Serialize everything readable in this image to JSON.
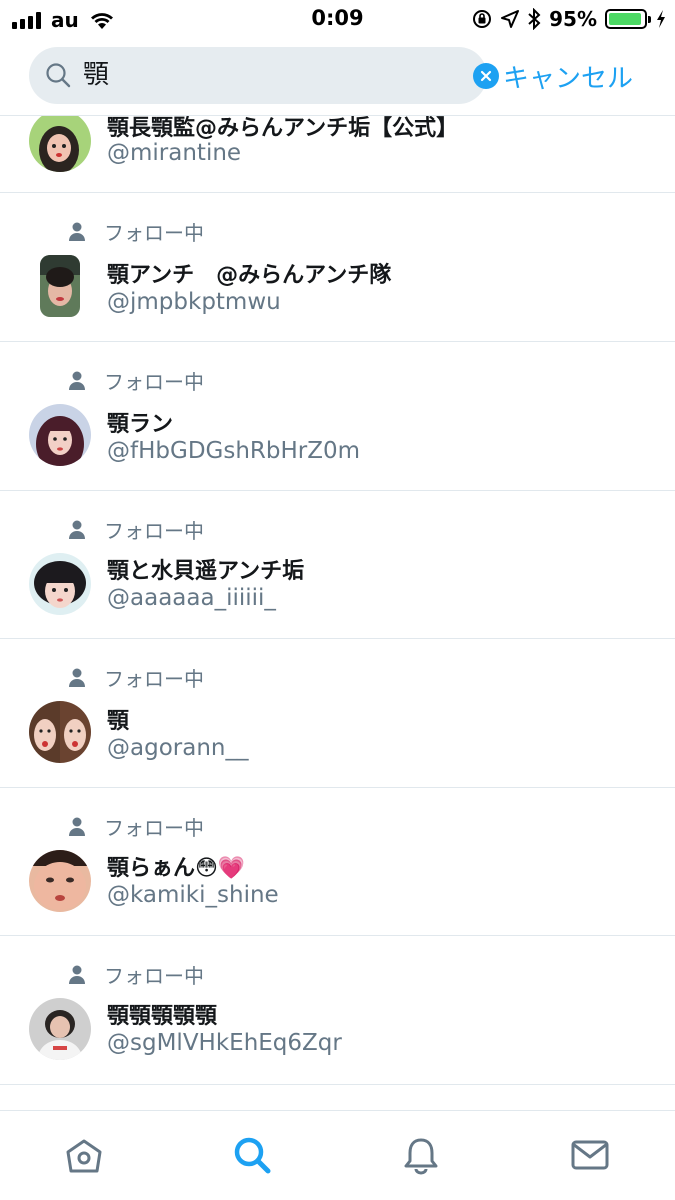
{
  "status_bar": {
    "carrier": "au",
    "time": "0:09",
    "battery_percent": "95%",
    "battery_level": 0.95
  },
  "search": {
    "query": "顎",
    "cancel_label": "キャンセル"
  },
  "accent_color": "#1da1f2",
  "following_label": "フォロー中",
  "results": [
    {
      "name": "顎長顎監@みらんアンチ垢【公式】",
      "handle": "@mirantine"
    },
    {
      "name": "顎アンチ　@みらんアンチ隊",
      "handle": "@jmpbkptmwu",
      "social": "フォロー中"
    },
    {
      "name": "顎ラン",
      "handle": "@fHbGDGshRbHrZ0m",
      "social": "フォロー中"
    },
    {
      "name": "顎と水貝遥アンチ垢",
      "handle": "@aaaaaa_iiiiii_",
      "social": "フォロー中"
    },
    {
      "name": "顎",
      "handle": "@agorann__",
      "social": "フォロー中"
    },
    {
      "name": "顎らぁん😳💗",
      "handle": "@kamiki_shine",
      "social": "フォロー中"
    },
    {
      "name": "顎顎顎顎顎",
      "handle": "@sgMlVHkEhEq6Zqr",
      "social": "フォロー中"
    }
  ],
  "tabs": [
    {
      "icon": "home-icon"
    },
    {
      "icon": "search-icon",
      "active": true
    },
    {
      "icon": "bell-icon"
    },
    {
      "icon": "mail-icon"
    }
  ]
}
